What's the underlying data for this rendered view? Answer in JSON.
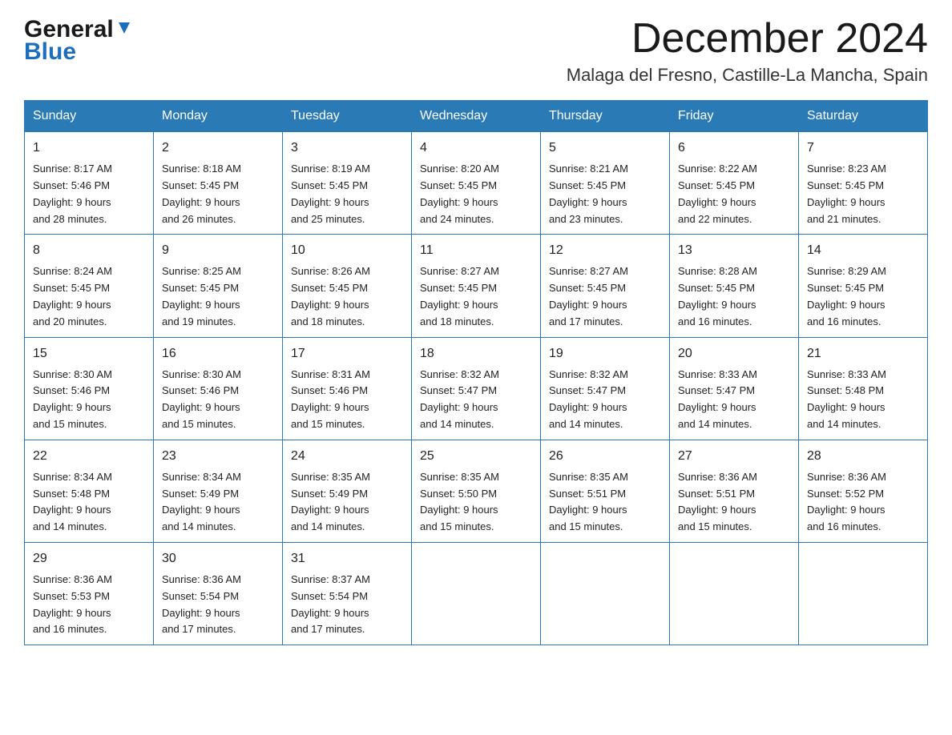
{
  "header": {
    "logo_general": "General",
    "logo_blue": "Blue",
    "month_title": "December 2024",
    "location": "Malaga del Fresno, Castille-La Mancha, Spain"
  },
  "days_of_week": [
    "Sunday",
    "Monday",
    "Tuesday",
    "Wednesday",
    "Thursday",
    "Friday",
    "Saturday"
  ],
  "weeks": [
    [
      {
        "day": "1",
        "sunrise": "8:17 AM",
        "sunset": "5:46 PM",
        "daylight": "9 hours and 28 minutes."
      },
      {
        "day": "2",
        "sunrise": "8:18 AM",
        "sunset": "5:45 PM",
        "daylight": "9 hours and 26 minutes."
      },
      {
        "day": "3",
        "sunrise": "8:19 AM",
        "sunset": "5:45 PM",
        "daylight": "9 hours and 25 minutes."
      },
      {
        "day": "4",
        "sunrise": "8:20 AM",
        "sunset": "5:45 PM",
        "daylight": "9 hours and 24 minutes."
      },
      {
        "day": "5",
        "sunrise": "8:21 AM",
        "sunset": "5:45 PM",
        "daylight": "9 hours and 23 minutes."
      },
      {
        "day": "6",
        "sunrise": "8:22 AM",
        "sunset": "5:45 PM",
        "daylight": "9 hours and 22 minutes."
      },
      {
        "day": "7",
        "sunrise": "8:23 AM",
        "sunset": "5:45 PM",
        "daylight": "9 hours and 21 minutes."
      }
    ],
    [
      {
        "day": "8",
        "sunrise": "8:24 AM",
        "sunset": "5:45 PM",
        "daylight": "9 hours and 20 minutes."
      },
      {
        "day": "9",
        "sunrise": "8:25 AM",
        "sunset": "5:45 PM",
        "daylight": "9 hours and 19 minutes."
      },
      {
        "day": "10",
        "sunrise": "8:26 AM",
        "sunset": "5:45 PM",
        "daylight": "9 hours and 18 minutes."
      },
      {
        "day": "11",
        "sunrise": "8:27 AM",
        "sunset": "5:45 PM",
        "daylight": "9 hours and 18 minutes."
      },
      {
        "day": "12",
        "sunrise": "8:27 AM",
        "sunset": "5:45 PM",
        "daylight": "9 hours and 17 minutes."
      },
      {
        "day": "13",
        "sunrise": "8:28 AM",
        "sunset": "5:45 PM",
        "daylight": "9 hours and 16 minutes."
      },
      {
        "day": "14",
        "sunrise": "8:29 AM",
        "sunset": "5:45 PM",
        "daylight": "9 hours and 16 minutes."
      }
    ],
    [
      {
        "day": "15",
        "sunrise": "8:30 AM",
        "sunset": "5:46 PM",
        "daylight": "9 hours and 15 minutes."
      },
      {
        "day": "16",
        "sunrise": "8:30 AM",
        "sunset": "5:46 PM",
        "daylight": "9 hours and 15 minutes."
      },
      {
        "day": "17",
        "sunrise": "8:31 AM",
        "sunset": "5:46 PM",
        "daylight": "9 hours and 15 minutes."
      },
      {
        "day": "18",
        "sunrise": "8:32 AM",
        "sunset": "5:47 PM",
        "daylight": "9 hours and 14 minutes."
      },
      {
        "day": "19",
        "sunrise": "8:32 AM",
        "sunset": "5:47 PM",
        "daylight": "9 hours and 14 minutes."
      },
      {
        "day": "20",
        "sunrise": "8:33 AM",
        "sunset": "5:47 PM",
        "daylight": "9 hours and 14 minutes."
      },
      {
        "day": "21",
        "sunrise": "8:33 AM",
        "sunset": "5:48 PM",
        "daylight": "9 hours and 14 minutes."
      }
    ],
    [
      {
        "day": "22",
        "sunrise": "8:34 AM",
        "sunset": "5:48 PM",
        "daylight": "9 hours and 14 minutes."
      },
      {
        "day": "23",
        "sunrise": "8:34 AM",
        "sunset": "5:49 PM",
        "daylight": "9 hours and 14 minutes."
      },
      {
        "day": "24",
        "sunrise": "8:35 AM",
        "sunset": "5:49 PM",
        "daylight": "9 hours and 14 minutes."
      },
      {
        "day": "25",
        "sunrise": "8:35 AM",
        "sunset": "5:50 PM",
        "daylight": "9 hours and 15 minutes."
      },
      {
        "day": "26",
        "sunrise": "8:35 AM",
        "sunset": "5:51 PM",
        "daylight": "9 hours and 15 minutes."
      },
      {
        "day": "27",
        "sunrise": "8:36 AM",
        "sunset": "5:51 PM",
        "daylight": "9 hours and 15 minutes."
      },
      {
        "day": "28",
        "sunrise": "8:36 AM",
        "sunset": "5:52 PM",
        "daylight": "9 hours and 16 minutes."
      }
    ],
    [
      {
        "day": "29",
        "sunrise": "8:36 AM",
        "sunset": "5:53 PM",
        "daylight": "9 hours and 16 minutes."
      },
      {
        "day": "30",
        "sunrise": "8:36 AM",
        "sunset": "5:54 PM",
        "daylight": "9 hours and 17 minutes."
      },
      {
        "day": "31",
        "sunrise": "8:37 AM",
        "sunset": "5:54 PM",
        "daylight": "9 hours and 17 minutes."
      },
      null,
      null,
      null,
      null
    ]
  ],
  "labels": {
    "sunrise": "Sunrise:",
    "sunset": "Sunset:",
    "daylight": "Daylight:"
  }
}
